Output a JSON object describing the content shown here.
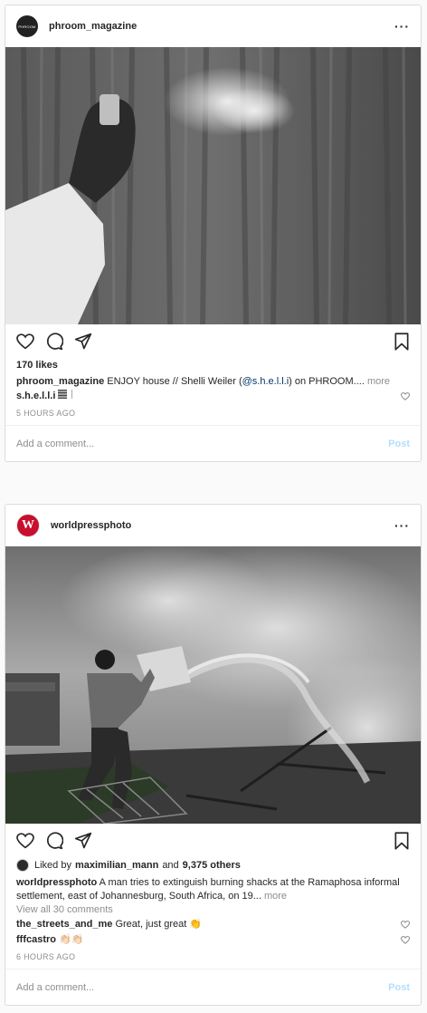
{
  "posts": [
    {
      "username": "phroom_magazine",
      "avatar_text": "PHROOM",
      "more_icon": "more-dots-icon",
      "likes": "170 likes",
      "caption_user": "phroom_magazine",
      "caption_pre": " ENJOY house // Shelli Weiler (",
      "caption_mention": "@s.h.e.l.l.i",
      "caption_post": ") on PHROOM....",
      "more_label": " more",
      "comments": [
        {
          "user": "s.h.e.l.l.i",
          "text": ""
        }
      ],
      "timestamp": "5 HOURS AGO",
      "add_comment_placeholder": "Add a comment...",
      "post_label": "Post"
    },
    {
      "username": "worldpressphoto",
      "avatar_letter": "W",
      "more_icon": "more-dots-icon",
      "liked_prefix": "Liked by",
      "liked_user": "maximilian_mann",
      "liked_and": "and",
      "liked_others": "9,375 others",
      "caption_user": "worldpressphoto",
      "caption_text": " A man tries to extinguish burning shacks at the Ramaphosa informal settlement, east of Johannesburg, South Africa, on 19...",
      "more_label": " more",
      "view_all": "View all 30 comments",
      "comments": [
        {
          "user": "the_streets_and_me",
          "text": " Great, just great 👏"
        },
        {
          "user": "fffcastro",
          "text": " 👏🏻👏🏻"
        }
      ],
      "timestamp": "6 HOURS AGO",
      "add_comment_placeholder": "Add a comment...",
      "post_label": "Post"
    }
  ],
  "colors": {
    "background": "#fafafa",
    "border": "#dbdbdb",
    "text": "#262626",
    "muted": "#8e8e8e",
    "mention": "#003569",
    "post_button": "#b2dffc",
    "wpp_brand": "#c8102e"
  }
}
